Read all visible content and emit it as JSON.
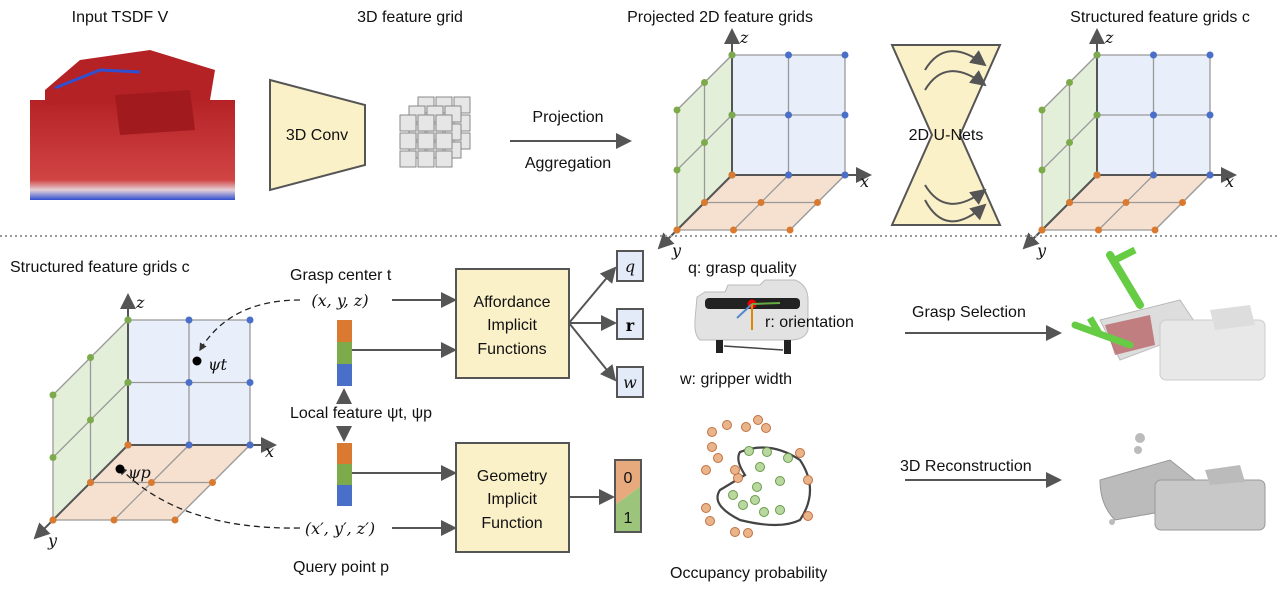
{
  "top": {
    "input_title": "Input TSDF V",
    "feature_grid_title": "3D feature grid",
    "conv_label": "3D Conv",
    "projection_label": "Projection",
    "aggregation_label": "Aggregation",
    "projected_title": "Projected 2D feature grids",
    "unet_label": "2D U-Nets",
    "structured_title": "Structured feature grids c",
    "axes": {
      "x": "x",
      "y": "y",
      "z": "z"
    }
  },
  "bottom": {
    "structured_title": "Structured feature grids c",
    "grasp_center_label": "Grasp center t",
    "grasp_coords": "(x, y, z)",
    "local_feature_label": "Local feature ψt, ψp",
    "query_coords": "(x′, y′, z′)",
    "query_point_label": "Query point p",
    "psi_t": "ψt",
    "psi_p": "ψp",
    "affordance_box": [
      "Affordance",
      "Implicit",
      "Functions"
    ],
    "geometry_box": [
      "Geometry",
      "Implicit",
      "Function"
    ],
    "outputs": {
      "q": "q",
      "r": "r",
      "w": "w"
    },
    "occupancy_values": [
      "0",
      "1"
    ],
    "q_desc": "q: grasp quality",
    "r_desc": "r: orientation",
    "w_desc": "w: gripper width",
    "occupancy_label": "Occupancy probability",
    "grasp_selection_label": "Grasp Selection",
    "reconstruction_label": "3D Reconstruction"
  },
  "colors": {
    "blue_plane": "#e8eefa",
    "green_plane": "#e4efd9",
    "orange_plane": "#f6e0cf",
    "blue_node": "#4a6fc8",
    "green_node": "#7daa4a",
    "orange_node": "#d97a30",
    "box_fill": "#fbf1c9",
    "tsdf_red": "#c0282a"
  }
}
